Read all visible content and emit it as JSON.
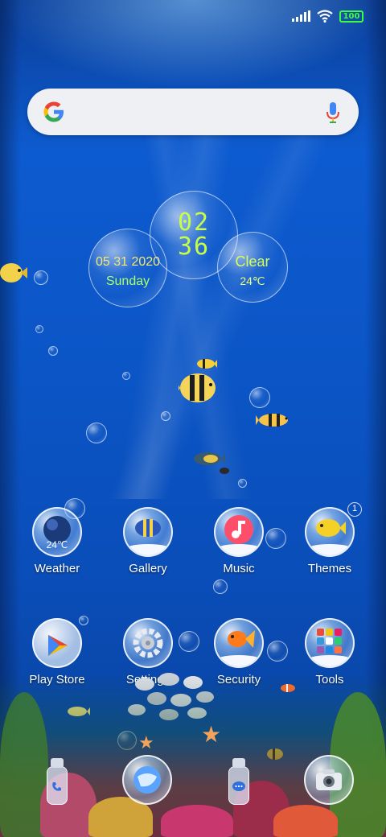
{
  "status_bar": {
    "battery": "100",
    "signal_icon": "signal-bars-icon",
    "wifi_icon": "wifi-icon",
    "battery_color": "#3cff3c"
  },
  "search": {
    "logo_icon": "google-g-icon",
    "mic_icon": "microphone-icon"
  },
  "clock_widget": {
    "date": "05 31 2020",
    "day": "Sunday",
    "hour": "02",
    "minute": "36",
    "weather": "Clear",
    "temperature": "24℃"
  },
  "apps_row1": [
    {
      "label": "Weather",
      "temp": "24℃",
      "icon": "planet-icon"
    },
    {
      "label": "Gallery",
      "icon": "fish-gallery-icon"
    },
    {
      "label": "Music",
      "icon": "music-note-icon"
    },
    {
      "label": "Themes",
      "icon": "yellow-fish-icon",
      "badge": "1"
    }
  ],
  "apps_row2": [
    {
      "label": "Play Store",
      "icon": "play-store-icon"
    },
    {
      "label": "Settings",
      "icon": "settings-gear-icon"
    },
    {
      "label": "Security",
      "icon": "goldfish-icon"
    },
    {
      "label": "Tools",
      "icon": "tools-folder-icon"
    }
  ],
  "dock": [
    {
      "icon": "phone-icon"
    },
    {
      "icon": "browser-icon"
    },
    {
      "icon": "messages-icon"
    },
    {
      "icon": "camera-icon"
    }
  ],
  "colors": {
    "accent_date": "#f3e870",
    "accent_time": "#c6ff46",
    "water": "#0b55c6"
  }
}
